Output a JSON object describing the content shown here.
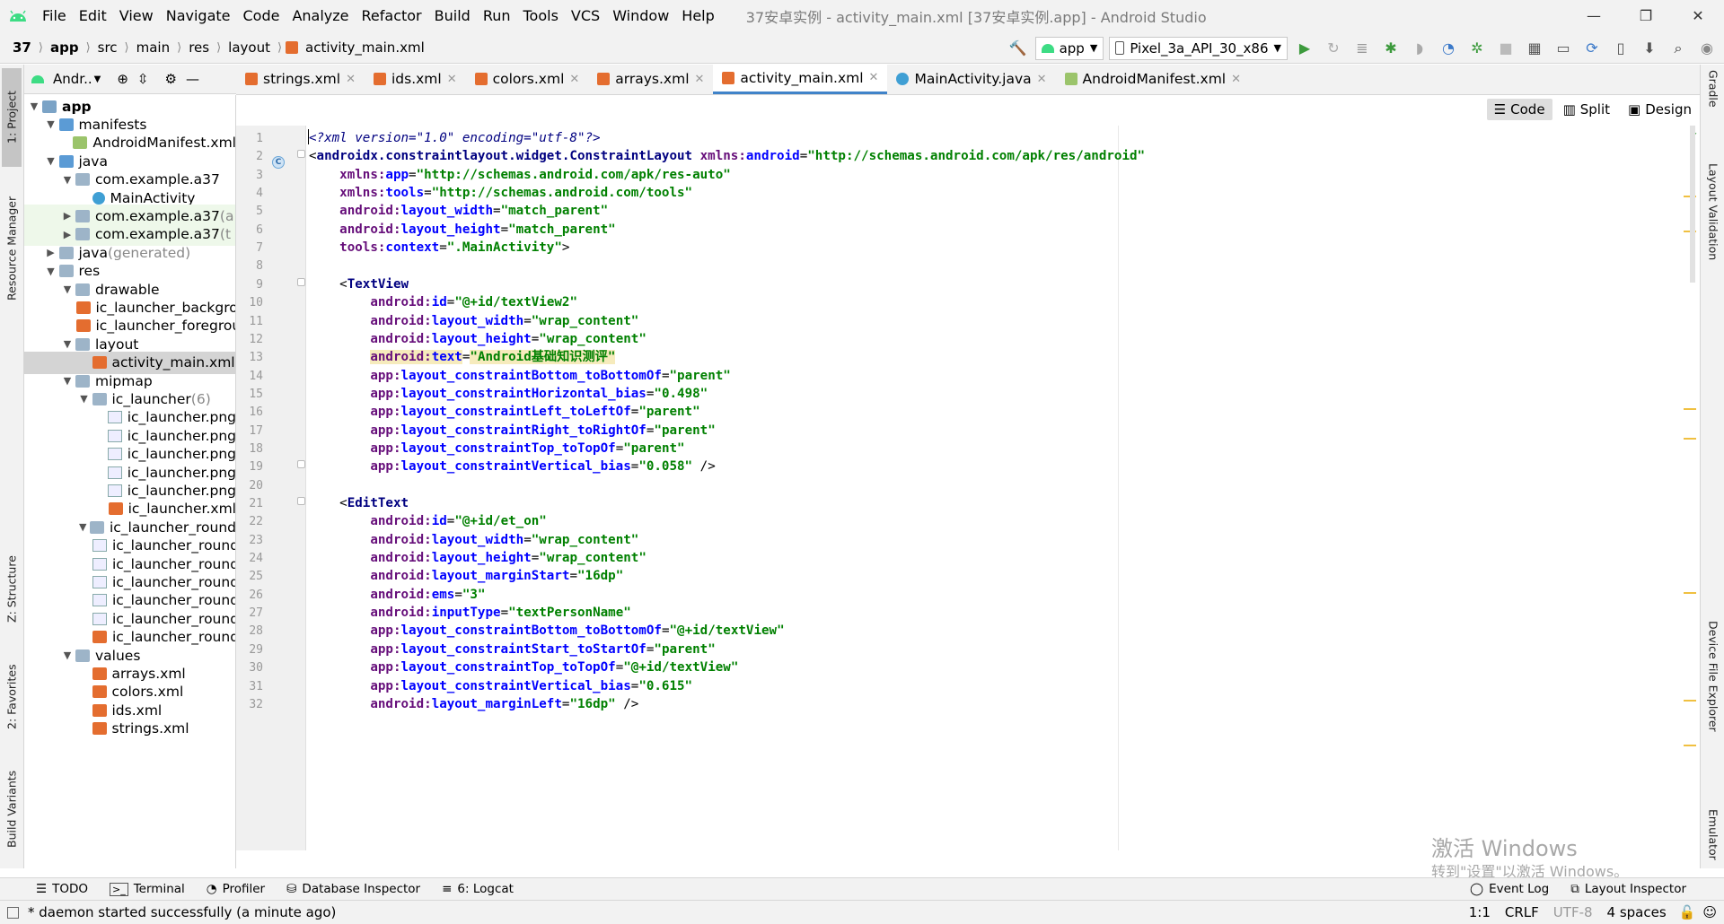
{
  "menubar": {
    "items": [
      "File",
      "Edit",
      "View",
      "Navigate",
      "Code",
      "Analyze",
      "Refactor",
      "Build",
      "Run",
      "Tools",
      "VCS",
      "Window",
      "Help"
    ],
    "window_title": "37安卓实例 - activity_main.xml [37安卓实例.app] - Android Studio"
  },
  "navbar": {
    "breadcrumbs": [
      "37",
      "app",
      "src",
      "main",
      "res",
      "layout",
      "activity_main.xml"
    ],
    "run_config": "app",
    "device": "Pixel_3a_API_30_x86"
  },
  "left_strip": {
    "tabs": [
      "1: Project",
      "Resource Manager",
      "Z: Structure",
      "2: Favorites",
      "Build Variants"
    ]
  },
  "right_strip": {
    "tabs": [
      "Gradle",
      "Layout Validation",
      "Device File Explorer",
      "Emulator"
    ]
  },
  "project_panel": {
    "view_label": "Andr..",
    "tree": [
      {
        "label": "app",
        "indent": 0,
        "arrow": "▼",
        "icon": "folder app",
        "bold": true
      },
      {
        "label": "manifests",
        "indent": 1,
        "arrow": "▼",
        "icon": "folder blue"
      },
      {
        "label": "AndroidManifest.xml",
        "indent": 2,
        "arrow": "",
        "icon": "file-mf"
      },
      {
        "label": "java",
        "indent": 1,
        "arrow": "▼",
        "icon": "folder blue"
      },
      {
        "label": "com.example.a37",
        "indent": 2,
        "arrow": "▼",
        "icon": "folder"
      },
      {
        "label": "MainActivity",
        "indent": 3,
        "arrow": "",
        "icon": "class-c"
      },
      {
        "label": "com.example.a37",
        "suffix": " (a",
        "indent": 2,
        "arrow": "▶",
        "icon": "folder",
        "tinted": true
      },
      {
        "label": "com.example.a37",
        "suffix": " (t",
        "indent": 2,
        "arrow": "▶",
        "icon": "folder",
        "tinted": true
      },
      {
        "label": "java",
        "suffix": " (generated)",
        "indent": 1,
        "arrow": "▶",
        "icon": "folder"
      },
      {
        "label": "res",
        "indent": 1,
        "arrow": "▼",
        "icon": "folder"
      },
      {
        "label": "drawable",
        "indent": 2,
        "arrow": "▼",
        "icon": "folder"
      },
      {
        "label": "ic_launcher_background.xml",
        "indent": 3,
        "arrow": "",
        "icon": "file-xml"
      },
      {
        "label": "ic_launcher_foreground.xml",
        "indent": 3,
        "arrow": "",
        "icon": "file-xml"
      },
      {
        "label": "layout",
        "indent": 2,
        "arrow": "▼",
        "icon": "folder"
      },
      {
        "label": "activity_main.xml",
        "indent": 3,
        "arrow": "",
        "icon": "file-xml",
        "selected": true
      },
      {
        "label": "mipmap",
        "indent": 2,
        "arrow": "▼",
        "icon": "folder"
      },
      {
        "label": "ic_launcher",
        "suffix": " (6)",
        "indent": 3,
        "arrow": "▼",
        "icon": "folder"
      },
      {
        "label": "ic_launcher.png",
        "indent": 4,
        "arrow": "",
        "icon": "file-png"
      },
      {
        "label": "ic_launcher.png",
        "indent": 4,
        "arrow": "",
        "icon": "file-png"
      },
      {
        "label": "ic_launcher.png",
        "indent": 4,
        "arrow": "",
        "icon": "file-png"
      },
      {
        "label": "ic_launcher.png",
        "indent": 4,
        "arrow": "",
        "icon": "file-png"
      },
      {
        "label": "ic_launcher.png",
        "indent": 4,
        "arrow": "",
        "icon": "file-png"
      },
      {
        "label": "ic_launcher.xml",
        "indent": 4,
        "arrow": "",
        "icon": "file-xml"
      },
      {
        "label": "ic_launcher_round",
        "indent": 3,
        "arrow": "▼",
        "icon": "folder"
      },
      {
        "label": "ic_launcher_round.png",
        "indent": 4,
        "arrow": "",
        "icon": "file-png"
      },
      {
        "label": "ic_launcher_round.png",
        "indent": 4,
        "arrow": "",
        "icon": "file-png"
      },
      {
        "label": "ic_launcher_round.png",
        "indent": 4,
        "arrow": "",
        "icon": "file-png"
      },
      {
        "label": "ic_launcher_round.png",
        "indent": 4,
        "arrow": "",
        "icon": "file-png"
      },
      {
        "label": "ic_launcher_round.png",
        "indent": 4,
        "arrow": "",
        "icon": "file-png"
      },
      {
        "label": "ic_launcher_round.xml",
        "indent": 4,
        "arrow": "",
        "icon": "file-xml"
      },
      {
        "label": "values",
        "indent": 2,
        "arrow": "▼",
        "icon": "folder"
      },
      {
        "label": "arrays.xml",
        "indent": 3,
        "arrow": "",
        "icon": "file-xml"
      },
      {
        "label": "colors.xml",
        "indent": 3,
        "arrow": "",
        "icon": "file-xml"
      },
      {
        "label": "ids.xml",
        "indent": 3,
        "arrow": "",
        "icon": "file-xml"
      },
      {
        "label": "strings.xml",
        "indent": 3,
        "arrow": "",
        "icon": "file-xml"
      }
    ]
  },
  "editor_tabs": [
    {
      "label": "strings.xml",
      "icon": "file-xml"
    },
    {
      "label": "ids.xml",
      "icon": "file-xml"
    },
    {
      "label": "colors.xml",
      "icon": "file-xml"
    },
    {
      "label": "arrays.xml",
      "icon": "file-xml"
    },
    {
      "label": "activity_main.xml",
      "icon": "file-xml",
      "active": true
    },
    {
      "label": "MainActivity.java",
      "icon": "class-c"
    },
    {
      "label": "AndroidManifest.xml",
      "icon": "file-mf"
    }
  ],
  "view_modes": {
    "code": "Code",
    "split": "Split",
    "design": "Design"
  },
  "code_lines": [
    {
      "n": "1",
      "t": [
        [
          "pi",
          "<?xml version=\"1.0\" encoding=\"utf-8\"?>"
        ]
      ]
    },
    {
      "n": "2",
      "t": [
        [
          "pun",
          "<"
        ],
        [
          "tag",
          "androidx.constraintlayout.widget.ConstraintLayout"
        ],
        [
          "pun",
          " "
        ],
        [
          "ns",
          "xmlns:"
        ],
        [
          "attr",
          "android"
        ],
        [
          "pun",
          "="
        ],
        [
          "val",
          "\"http://schemas.android.com/apk/res/android\""
        ]
      ]
    },
    {
      "n": "3",
      "t": [
        [
          "pun",
          "    "
        ],
        [
          "ns",
          "xmlns:"
        ],
        [
          "attr",
          "app"
        ],
        [
          "pun",
          "="
        ],
        [
          "val",
          "\"http://schemas.android.com/apk/res-auto\""
        ]
      ]
    },
    {
      "n": "4",
      "t": [
        [
          "pun",
          "    "
        ],
        [
          "ns",
          "xmlns:"
        ],
        [
          "attr",
          "tools"
        ],
        [
          "pun",
          "="
        ],
        [
          "val",
          "\"http://schemas.android.com/tools\""
        ]
      ]
    },
    {
      "n": "5",
      "t": [
        [
          "pun",
          "    "
        ],
        [
          "ns",
          "android:"
        ],
        [
          "attr",
          "layout_width"
        ],
        [
          "pun",
          "="
        ],
        [
          "val",
          "\"match_parent\""
        ]
      ]
    },
    {
      "n": "6",
      "t": [
        [
          "pun",
          "    "
        ],
        [
          "ns",
          "android:"
        ],
        [
          "attr",
          "layout_height"
        ],
        [
          "pun",
          "="
        ],
        [
          "val",
          "\"match_parent\""
        ]
      ]
    },
    {
      "n": "7",
      "t": [
        [
          "pun",
          "    "
        ],
        [
          "ns",
          "tools:"
        ],
        [
          "attr",
          "context"
        ],
        [
          "pun",
          "="
        ],
        [
          "val",
          "\".MainActivity\""
        ],
        [
          "pun",
          ">"
        ]
      ]
    },
    {
      "n": "8",
      "t": []
    },
    {
      "n": "9",
      "t": [
        [
          "pun",
          "    <"
        ],
        [
          "tag",
          "TextView"
        ]
      ]
    },
    {
      "n": "10",
      "t": [
        [
          "pun",
          "        "
        ],
        [
          "ns",
          "android:"
        ],
        [
          "attr",
          "id"
        ],
        [
          "pun",
          "="
        ],
        [
          "val",
          "\"@+id/textView2\""
        ]
      ]
    },
    {
      "n": "11",
      "t": [
        [
          "pun",
          "        "
        ],
        [
          "ns",
          "android:"
        ],
        [
          "attr",
          "layout_width"
        ],
        [
          "pun",
          "="
        ],
        [
          "val",
          "\"wrap_content\""
        ]
      ]
    },
    {
      "n": "12",
      "t": [
        [
          "pun",
          "        "
        ],
        [
          "ns",
          "android:"
        ],
        [
          "attr",
          "layout_height"
        ],
        [
          "pun",
          "="
        ],
        [
          "val",
          "\"wrap_content\""
        ]
      ]
    },
    {
      "n": "13",
      "hl": "warn",
      "t": [
        [
          "pun",
          "        "
        ],
        [
          "ns",
          "android:"
        ],
        [
          "attr",
          "text"
        ],
        [
          "pun",
          "="
        ],
        [
          "val",
          "\"Android基础知识测评\""
        ]
      ]
    },
    {
      "n": "14",
      "t": [
        [
          "pun",
          "        "
        ],
        [
          "ns",
          "app:"
        ],
        [
          "attr",
          "layout_constraintBottom_toBottomOf"
        ],
        [
          "pun",
          "="
        ],
        [
          "val",
          "\"parent\""
        ]
      ]
    },
    {
      "n": "15",
      "t": [
        [
          "pun",
          "        "
        ],
        [
          "ns",
          "app:"
        ],
        [
          "attr",
          "layout_constraintHorizontal_bias"
        ],
        [
          "pun",
          "="
        ],
        [
          "val",
          "\"0.498\""
        ]
      ]
    },
    {
      "n": "16",
      "t": [
        [
          "pun",
          "        "
        ],
        [
          "ns",
          "app:"
        ],
        [
          "attr",
          "layout_constraintLeft_toLeftOf"
        ],
        [
          "pun",
          "="
        ],
        [
          "val",
          "\"parent\""
        ]
      ]
    },
    {
      "n": "17",
      "t": [
        [
          "pun",
          "        "
        ],
        [
          "ns",
          "app:"
        ],
        [
          "attr",
          "layout_constraintRight_toRightOf"
        ],
        [
          "pun",
          "="
        ],
        [
          "val",
          "\"parent\""
        ]
      ]
    },
    {
      "n": "18",
      "t": [
        [
          "pun",
          "        "
        ],
        [
          "ns",
          "app:"
        ],
        [
          "attr",
          "layout_constraintTop_toTopOf"
        ],
        [
          "pun",
          "="
        ],
        [
          "val",
          "\"parent\""
        ]
      ]
    },
    {
      "n": "19",
      "t": [
        [
          "pun",
          "        "
        ],
        [
          "ns",
          "app:"
        ],
        [
          "attr",
          "layout_constraintVertical_bias"
        ],
        [
          "pun",
          "="
        ],
        [
          "val",
          "\"0.058\""
        ],
        [
          "pun",
          " />"
        ]
      ]
    },
    {
      "n": "20",
      "t": []
    },
    {
      "n": "21",
      "t": [
        [
          "pun",
          "    <"
        ],
        [
          "tag",
          "EditText"
        ]
      ]
    },
    {
      "n": "22",
      "t": [
        [
          "pun",
          "        "
        ],
        [
          "ns",
          "android:"
        ],
        [
          "attr",
          "id"
        ],
        [
          "pun",
          "="
        ],
        [
          "val",
          "\"@+id/et_on\""
        ]
      ]
    },
    {
      "n": "23",
      "t": [
        [
          "pun",
          "        "
        ],
        [
          "ns",
          "android:"
        ],
        [
          "attr",
          "layout_width"
        ],
        [
          "pun",
          "="
        ],
        [
          "val",
          "\"wrap_content\""
        ]
      ]
    },
    {
      "n": "24",
      "t": [
        [
          "pun",
          "        "
        ],
        [
          "ns",
          "android:"
        ],
        [
          "attr",
          "layout_height"
        ],
        [
          "pun",
          "="
        ],
        [
          "val",
          "\"wrap_content\""
        ]
      ]
    },
    {
      "n": "25",
      "t": [
        [
          "pun",
          "        "
        ],
        [
          "ns",
          "android:"
        ],
        [
          "attr",
          "layout_marginStart"
        ],
        [
          "pun",
          "="
        ],
        [
          "val",
          "\"16dp\""
        ]
      ]
    },
    {
      "n": "26",
      "t": [
        [
          "pun",
          "        "
        ],
        [
          "ns",
          "android:"
        ],
        [
          "attr",
          "ems"
        ],
        [
          "pun",
          "="
        ],
        [
          "val",
          "\"3\""
        ]
      ]
    },
    {
      "n": "27",
      "t": [
        [
          "pun",
          "        "
        ],
        [
          "ns",
          "android:"
        ],
        [
          "attr",
          "inputType"
        ],
        [
          "pun",
          "="
        ],
        [
          "val",
          "\"textPersonName\""
        ]
      ]
    },
    {
      "n": "28",
      "t": [
        [
          "pun",
          "        "
        ],
        [
          "ns",
          "app:"
        ],
        [
          "attr",
          "layout_constraintBottom_toBottomOf"
        ],
        [
          "pun",
          "="
        ],
        [
          "val",
          "\"@+id/textView\""
        ]
      ]
    },
    {
      "n": "29",
      "t": [
        [
          "pun",
          "        "
        ],
        [
          "ns",
          "app:"
        ],
        [
          "attr",
          "layout_constraintStart_toStartOf"
        ],
        [
          "pun",
          "="
        ],
        [
          "val",
          "\"parent\""
        ]
      ]
    },
    {
      "n": "30",
      "t": [
        [
          "pun",
          "        "
        ],
        [
          "ns",
          "app:"
        ],
        [
          "attr",
          "layout_constraintTop_toTopOf"
        ],
        [
          "pun",
          "="
        ],
        [
          "val",
          "\"@+id/textView\""
        ]
      ]
    },
    {
      "n": "31",
      "t": [
        [
          "pun",
          "        "
        ],
        [
          "ns",
          "app:"
        ],
        [
          "attr",
          "layout_constraintVertical_bias"
        ],
        [
          "pun",
          "="
        ],
        [
          "val",
          "\"0.615\""
        ]
      ]
    },
    {
      "n": "32",
      "t": [
        [
          "pun",
          "        "
        ],
        [
          "ns",
          "android:"
        ],
        [
          "attr",
          "layout_marginLeft"
        ],
        [
          "pun",
          "="
        ],
        [
          "val",
          "\"16dp\""
        ],
        [
          "pun",
          " />"
        ]
      ]
    }
  ],
  "bottom_tools": {
    "todo": "TODO",
    "terminal": "Terminal",
    "profiler": "Profiler",
    "database": "Database Inspector",
    "logcat": "6: Logcat",
    "event_log": "Event Log",
    "layout_inspector": "Layout Inspector"
  },
  "status": {
    "message": "* daemon started successfully (a minute ago)",
    "position": "1:1",
    "line_sep": "CRLF",
    "encoding": "UTF-8",
    "indent": "4 spaces"
  },
  "watermark": {
    "line1": "激活 Windows",
    "line2": "转到\"设置\"以激活 Windows。"
  }
}
